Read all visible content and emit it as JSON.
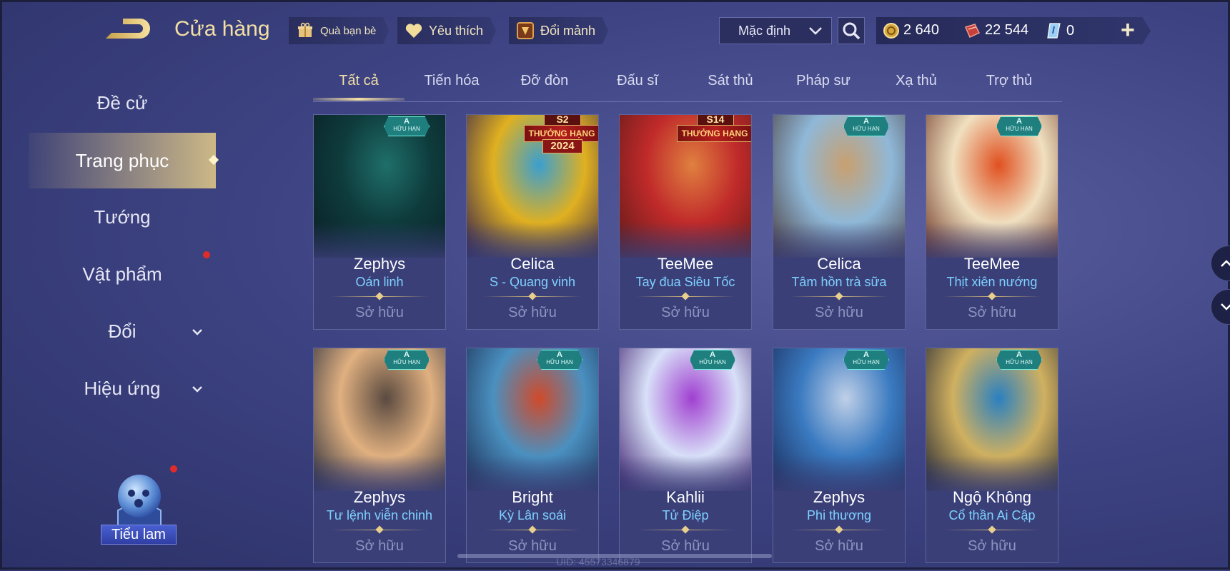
{
  "header": {
    "title": "Cửa hàng",
    "chips": [
      {
        "label": "Quà bạn bè",
        "icon": "gift-icon"
      },
      {
        "label": "Yêu thích",
        "icon": "heart-icon"
      },
      {
        "label": "Đổi mảnh",
        "icon": "fragment-icon"
      }
    ],
    "sort_value": "Mặc định",
    "currencies": [
      {
        "icon": "gold-coin-icon",
        "value": "2 640"
      },
      {
        "icon": "voucher-icon",
        "value": "22 544"
      },
      {
        "icon": "diamond-icon",
        "value": "0"
      }
    ]
  },
  "sidebar": {
    "items": [
      {
        "label": "Đề cử"
      },
      {
        "label": "Trang phục",
        "active": true
      },
      {
        "label": "Tướng"
      },
      {
        "label": "Vật phẩm"
      },
      {
        "label": "Đổi"
      },
      {
        "label": "Hiệu ứng"
      }
    ],
    "mascot_label": "Tiểu lam"
  },
  "tabs": [
    "Tất cả",
    "Tiến hóa",
    "Đỡ đòn",
    "Đấu sĩ",
    "Sát thủ",
    "Pháp sư",
    "Xạ thủ",
    "Trợ thủ"
  ],
  "active_tab": "Tất cả",
  "badge": {
    "grade": "A",
    "text": "HỮU HẠN"
  },
  "cards": [
    {
      "hero": "Zephys",
      "skin": "Oán linh",
      "status": "Sở hữu",
      "colors": [
        "#0e3b3c",
        "#1f6f6a",
        "#0a1e24"
      ]
    },
    {
      "hero": "Celica",
      "skin": "S - Quang vinh",
      "status": "Sở hữu",
      "rank": {
        "top": "S2",
        "banner": "THƯỞNG HẠNG",
        "year": "2024"
      },
      "colors": [
        "#e0b020",
        "#3a9fd0",
        "#2a1a50"
      ]
    },
    {
      "hero": "TeeMee",
      "skin": "Tay đua Siêu Tốc",
      "status": "Sở hữu",
      "rank": {
        "top": "S14",
        "banner": "THƯỞNG HẠNG",
        "year": ""
      },
      "colors": [
        "#c02a2a",
        "#e08040",
        "#5a1a18"
      ]
    },
    {
      "hero": "Celica",
      "skin": "Tâm hồn trà sữa",
      "status": "Sở hữu",
      "colors": [
        "#8fb8d8",
        "#c8a070",
        "#4a3a3a"
      ]
    },
    {
      "hero": "TeeMee",
      "skin": "Thịt xiên nướng",
      "status": "Sở hữu",
      "colors": [
        "#f0e0c0",
        "#e05020",
        "#6a3020"
      ]
    },
    {
      "hero": "Zephys",
      "skin": "Tư lệnh viễn chinh",
      "status": "Sở hữu",
      "colors": [
        "#e0b080",
        "#5a4a40",
        "#202638"
      ]
    },
    {
      "hero": "Bright",
      "skin": "Kỳ Lân soái",
      "status": "Sở hữu",
      "colors": [
        "#4a90c0",
        "#d04a2a",
        "#1a2a50"
      ]
    },
    {
      "hero": "Kahlii",
      "skin": "Tử Điệp",
      "status": "Sở hữu",
      "colors": [
        "#d8e0f8",
        "#a040d0",
        "#3a1a6a"
      ]
    },
    {
      "hero": "Zephys",
      "skin": "Phi thương",
      "status": "Sở hữu",
      "colors": [
        "#3a7ac0",
        "#c0d0e8",
        "#1a2a58"
      ]
    },
    {
      "hero": "Ngộ Không",
      "skin": "Cổ thần Ai Cập",
      "status": "Sở hữu",
      "colors": [
        "#d0b060",
        "#2a80c0",
        "#1a2030"
      ]
    }
  ],
  "uid_text": "UID: 45573346879"
}
